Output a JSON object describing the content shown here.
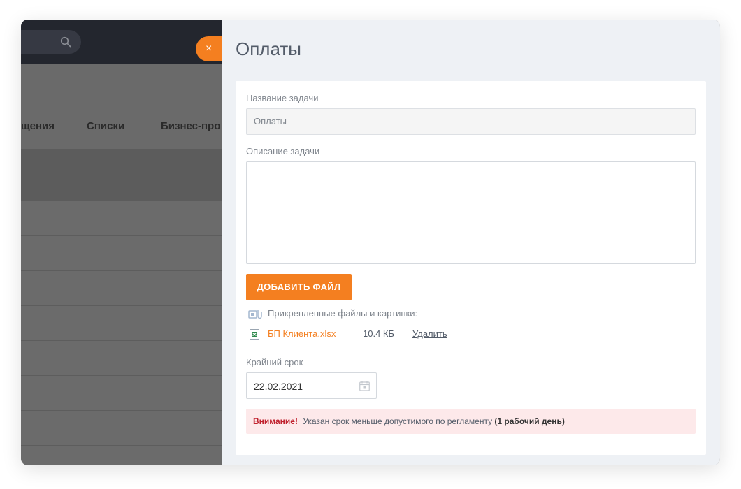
{
  "background": {
    "nav_items": [
      "щения",
      "Списки",
      "Бизнес-про"
    ],
    "search_icon": "search-icon"
  },
  "close_button": {
    "label": "×",
    "icon": "close-icon"
  },
  "panel": {
    "title": "Оплаты"
  },
  "form": {
    "task_name_label": "Название задачи",
    "task_name_value": "Оплаты",
    "task_description_label": "Описание задачи",
    "task_description_value": "",
    "add_file_label": "ДОБАВИТЬ ФАЙЛ",
    "attached_label": "Прикрепленные файлы и картинки:",
    "attached_icon": "attachment-icon",
    "files": [
      {
        "name": "БП Клиента.xlsx",
        "size": "10.4 КБ",
        "delete_label": "Удалить",
        "icon": "excel-icon"
      }
    ],
    "deadline_label": "Крайний срок",
    "deadline_value": "22.02.2021",
    "calendar_icon": "calendar-icon",
    "alert": {
      "strong": "Внимание!",
      "text": "Указан срок меньше допустимого по регламенту ",
      "bold": "(1 рабочий день)"
    }
  },
  "colors": {
    "accent": "#f47f20",
    "alert_bg": "#fde9ea",
    "alert_text": "#c0222e"
  }
}
